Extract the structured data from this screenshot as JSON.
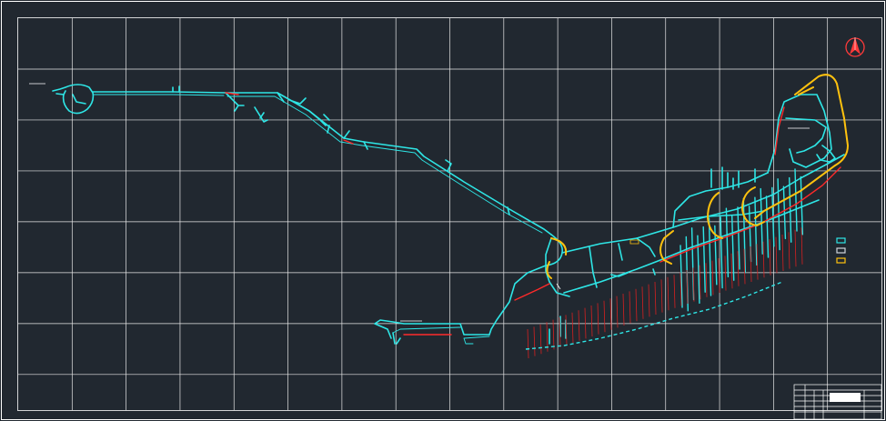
{
  "drawing": {
    "background_color": "#212830",
    "grid_color": "#e6e6e6",
    "frame_color": "#ffffff",
    "tunnel_color": "#2ee6e6",
    "main_route_color": "#ff2a2a",
    "ramp_color": "#ffc20e",
    "shaft_line_color": "#d42020",
    "grid_columns": 16,
    "grid_rows": 7
  },
  "north_arrow": {
    "icon": "north-arrow-icon",
    "color": "#ff3a3a"
  },
  "legend": {
    "items": [
      {
        "swatch_color": "#2ee6e6"
      },
      {
        "swatch_color": "#cfd6dc"
      },
      {
        "swatch_color": "#ffc20e"
      }
    ]
  },
  "title_block": {
    "present": true
  }
}
